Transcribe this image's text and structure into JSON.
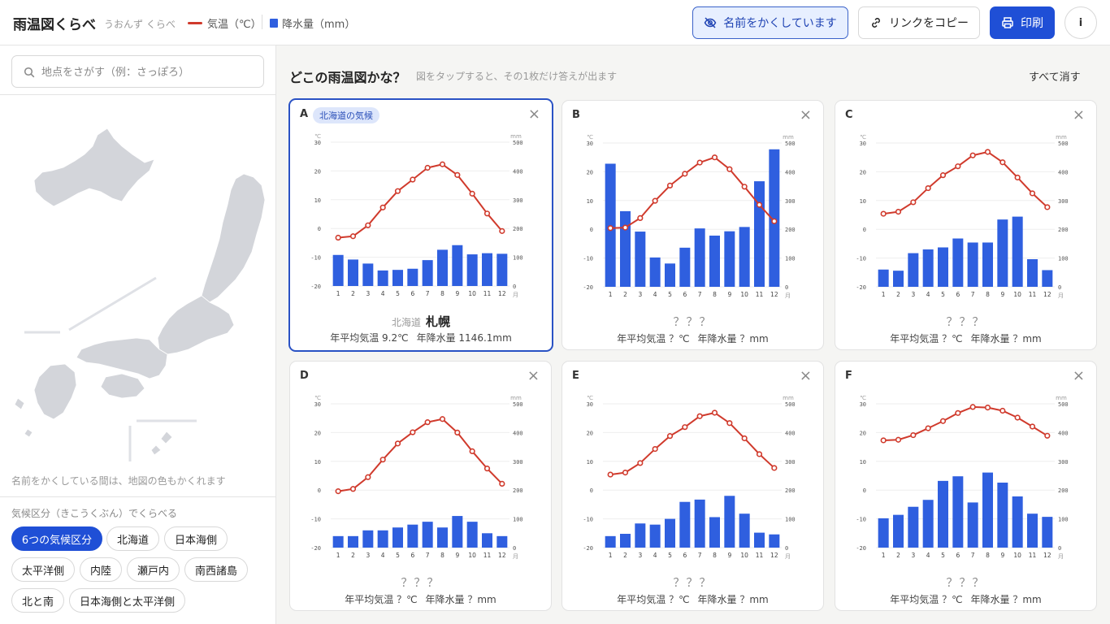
{
  "header": {
    "title": "雨温図くらべ",
    "subtitle": "うおんず くらべ",
    "legend_temp": "気温（℃）",
    "legend_precip": "降水量（mm）",
    "hide_names_button": "名前をかくしています",
    "copy_link_button": "リンクをコピー",
    "print_button": "印刷",
    "info_button": "i"
  },
  "sidebar": {
    "search_placeholder": "地点をさがす（例：さっぽろ）",
    "map_note": "名前をかくしている間は、地図の色もかくれます",
    "category_label": "気候区分（きこうくぶん）でくらべる",
    "chips": [
      "6つの気候区分",
      "北海道",
      "日本海側",
      "太平洋側",
      "内陸",
      "瀬戸内",
      "南西諸島",
      "北と南",
      "日本海側と太平洋側"
    ]
  },
  "main": {
    "title": "どこの雨温図かな？",
    "hint": "図をタップすると、その1枚だけ答えが出ます",
    "clear_all": "すべて消す"
  },
  "axis": {
    "temp_unit": "℃",
    "precip_unit": "mm",
    "month_unit": "月",
    "temp_ticks": [
      "30",
      "20",
      "10",
      "0",
      "-10",
      "-20"
    ],
    "precip_ticks": [
      "500",
      "400",
      "300",
      "200",
      "100",
      "0"
    ],
    "months": [
      "1",
      "2",
      "3",
      "4",
      "5",
      "6",
      "7",
      "8",
      "9",
      "10",
      "11",
      "12"
    ]
  },
  "colors": {
    "bar": "#2f5fdf",
    "line": "#d03a2c",
    "accent": "#1f4fd6"
  },
  "cards": [
    {
      "letter": "A",
      "badge": "北海道の気候",
      "revealed": true,
      "pref": "北海道",
      "city": "札幌",
      "hidden_name": "",
      "avg_temp": "年平均気温 9.2℃",
      "annual_precip": "年降水量 1146.1mm"
    },
    {
      "letter": "B",
      "badge": "",
      "revealed": false,
      "pref": "",
      "city": "",
      "hidden_name": "？？？",
      "avg_temp": "年平均気温 ？℃",
      "annual_precip": "年降水量 ？mm"
    },
    {
      "letter": "C",
      "badge": "",
      "revealed": false,
      "pref": "",
      "city": "",
      "hidden_name": "？？？",
      "avg_temp": "年平均気温 ？℃",
      "annual_precip": "年降水量 ？mm"
    },
    {
      "letter": "D",
      "badge": "",
      "revealed": false,
      "pref": "",
      "city": "",
      "hidden_name": "？？？",
      "avg_temp": "年平均気温 ？℃",
      "annual_precip": "年降水量 ？mm"
    },
    {
      "letter": "E",
      "badge": "",
      "revealed": false,
      "pref": "",
      "city": "",
      "hidden_name": "？？？",
      "avg_temp": "年平均気温 ？℃",
      "annual_precip": "年降水量 ？mm"
    },
    {
      "letter": "F",
      "badge": "",
      "revealed": false,
      "pref": "",
      "city": "",
      "hidden_name": "？？？",
      "avg_temp": "年平均気温 ？℃",
      "annual_precip": "年降水量 ？mm"
    }
  ],
  "chart_data": [
    {
      "type": "bar+line",
      "label": "A",
      "x": [
        "1",
        "2",
        "3",
        "4",
        "5",
        "6",
        "7",
        "8",
        "9",
        "10",
        "11",
        "12"
      ],
      "temp": [
        -3.2,
        -2.7,
        1.1,
        7.3,
        13.0,
        17.0,
        21.1,
        22.3,
        18.6,
        12.1,
        5.2,
        -0.9
      ],
      "precip": [
        108,
        92,
        78,
        54,
        56,
        60,
        90,
        126,
        142,
        110,
        114,
        112
      ],
      "temp_range": [
        -20,
        30
      ],
      "precip_range": [
        0,
        500
      ]
    },
    {
      "type": "bar+line",
      "label": "B",
      "x": [
        "1",
        "2",
        "3",
        "4",
        "5",
        "6",
        "7",
        "8",
        "9",
        "10",
        "11",
        "12"
      ],
      "temp": [
        0.4,
        0.6,
        3.9,
        9.9,
        15.2,
        19.3,
        23.2,
        25.0,
        20.9,
        14.8,
        8.5,
        2.8
      ],
      "precip": [
        428,
        263,
        192,
        102,
        81,
        136,
        203,
        178,
        193,
        208,
        367,
        478
      ],
      "temp_range": [
        -20,
        30
      ],
      "precip_range": [
        0,
        500
      ]
    },
    {
      "type": "bar+line",
      "label": "C",
      "x": [
        "1",
        "2",
        "3",
        "4",
        "5",
        "6",
        "7",
        "8",
        "9",
        "10",
        "11",
        "12"
      ],
      "temp": [
        5.4,
        6.1,
        9.4,
        14.3,
        18.8,
        21.9,
        25.7,
        26.9,
        23.3,
        18.0,
        12.5,
        7.7
      ],
      "precip": [
        60,
        56,
        117,
        130,
        137,
        168,
        154,
        154,
        234,
        244,
        96,
        58
      ],
      "temp_range": [
        -20,
        30
      ],
      "precip_range": [
        0,
        500
      ]
    },
    {
      "type": "bar+line",
      "label": "D",
      "x": [
        "1",
        "2",
        "3",
        "4",
        "5",
        "6",
        "7",
        "8",
        "9",
        "10",
        "11",
        "12"
      ],
      "temp": [
        -0.4,
        0.4,
        4.5,
        10.6,
        16.2,
        20.1,
        23.6,
        24.7,
        20.0,
        13.5,
        7.5,
        2.2
      ],
      "precip": [
        40,
        40,
        60,
        60,
        70,
        80,
        90,
        70,
        110,
        90,
        50,
        40
      ],
      "temp_range": [
        -20,
        30
      ],
      "precip_range": [
        0,
        500
      ]
    },
    {
      "type": "bar+line",
      "label": "E",
      "x": [
        "1",
        "2",
        "3",
        "4",
        "5",
        "6",
        "7",
        "8",
        "9",
        "10",
        "11",
        "12"
      ],
      "temp": [
        5.4,
        6.1,
        9.4,
        14.3,
        18.8,
        21.9,
        25.7,
        26.9,
        23.3,
        18.0,
        12.5,
        7.7
      ],
      "precip": [
        40,
        48,
        84,
        80,
        100,
        159,
        167,
        106,
        180,
        118,
        52,
        46
      ],
      "temp_range": [
        -20,
        30
      ],
      "precip_range": [
        0,
        500
      ]
    },
    {
      "type": "bar+line",
      "label": "F",
      "x": [
        "1",
        "2",
        "3",
        "4",
        "5",
        "6",
        "7",
        "8",
        "9",
        "10",
        "11",
        "12"
      ],
      "temp": [
        17.3,
        17.5,
        19.1,
        21.5,
        24.0,
        26.8,
        28.9,
        28.7,
        27.6,
        25.2,
        22.1,
        18.9
      ],
      "precip": [
        102,
        114,
        142,
        166,
        232,
        248,
        157,
        261,
        226,
        178,
        118,
        107
      ],
      "temp_range": [
        -20,
        30
      ],
      "precip_range": [
        0,
        500
      ]
    }
  ]
}
